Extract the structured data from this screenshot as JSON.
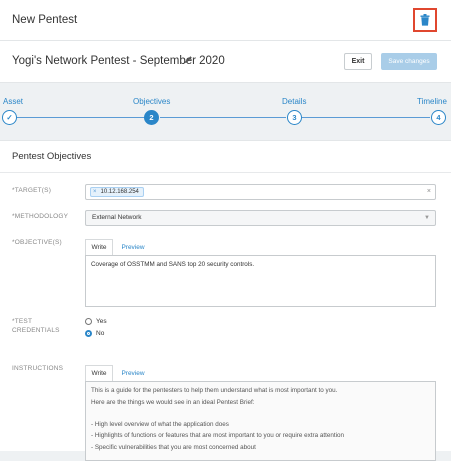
{
  "top_bar": {
    "title": "New Pentest"
  },
  "header": {
    "pentest_name": "Yogi's Network Pentest - September 2020",
    "exit_label": "Exit",
    "save_label": "Save changes"
  },
  "stepper": {
    "steps": [
      {
        "label": "Asset",
        "marker": "✓",
        "state": "complete"
      },
      {
        "label": "Objectives",
        "marker": "2",
        "state": "active"
      },
      {
        "label": "Details",
        "marker": "3",
        "state": "pending"
      },
      {
        "label": "Timeline",
        "marker": "4",
        "state": "pending"
      }
    ]
  },
  "form": {
    "section_title": "Pentest Objectives",
    "target": {
      "label": "*TARGET(S)",
      "chips": [
        "10.12.168.254"
      ]
    },
    "methodology": {
      "label": "*METHODOLOGY",
      "value": "External Network"
    },
    "objectives": {
      "label": "*OBJECTIVE(S)",
      "tab_write": "Write",
      "tab_preview": "Preview",
      "value": "Coverage of OSSTMM and SANS top 20 security controls."
    },
    "credentials": {
      "label_line1": "*TEST",
      "label_line2": "CREDENTIALS",
      "options": [
        {
          "label": "Yes",
          "selected": false
        },
        {
          "label": "No",
          "selected": true
        }
      ]
    },
    "instructions": {
      "label": "INSTRUCTIONS",
      "tab_write": "Write",
      "tab_preview": "Preview",
      "lines": [
        "This is a guide for the pentesters to help them understand what is most important to you.",
        "Here are the things we would see in an ideal Pentest Brief:",
        "",
        "- High level overview of what the application does",
        "- Highlights of functions or features that are most important to you or require extra attention",
        "- Specific vulnerabilities that you are most concerned about"
      ]
    }
  },
  "colors": {
    "accent": "#2a86c8",
    "danger_outline": "#e0472f",
    "save_disabled": "#a9cde8"
  }
}
